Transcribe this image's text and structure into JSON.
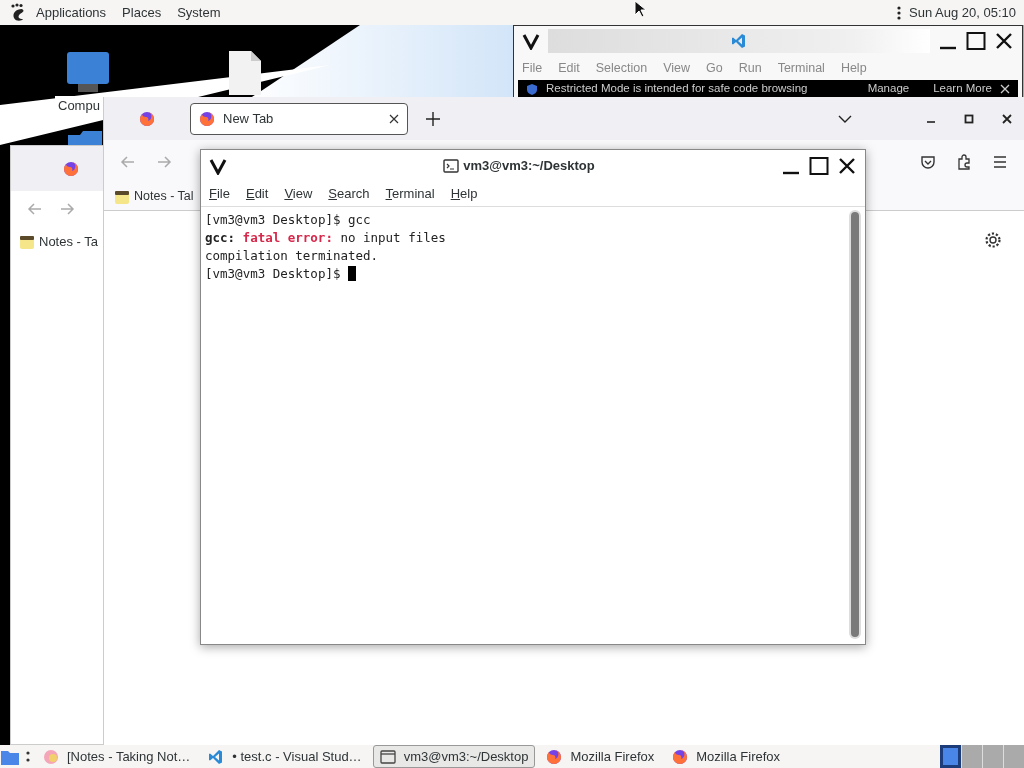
{
  "top_panel": {
    "menus": [
      "Applications",
      "Places",
      "System"
    ],
    "clock": "Sun Aug 20, 05:10"
  },
  "desktop_icons": [
    {
      "label": "Compu"
    }
  ],
  "vscode_window": {
    "menu": [
      "File",
      "Edit",
      "Selection",
      "View",
      "Go",
      "Run",
      "Terminal",
      "Help"
    ],
    "banner": {
      "text": "Restricted Mode is intended for safe code browsing",
      "actions": [
        "Manage",
        "Learn More"
      ]
    }
  },
  "firefox_back": {
    "bookmark": "Notes - Ta"
  },
  "firefox_main": {
    "tabs": [
      {
        "label": "New Tab",
        "selected": true
      }
    ],
    "bookmark": "Notes - Tal"
  },
  "terminal": {
    "title": "vm3@vm3:~/Desktop",
    "menu": [
      "File",
      "Edit",
      "View",
      "Search",
      "Terminal",
      "Help"
    ],
    "lines": [
      {
        "kind": "output",
        "text": "[vm3@vm3 Desktop]$ gcc"
      },
      {
        "kind": "error",
        "program": "gcc:",
        "label": "fatal error:",
        "message": "no input files"
      },
      {
        "kind": "output",
        "text": "compilation terminated."
      },
      {
        "kind": "output",
        "text": "[vm3@vm3 Desktop]$"
      }
    ],
    "cursor": true
  },
  "taskbar": {
    "items": [
      {
        "kind": "notes",
        "label": "[Notes - Taking Not…",
        "selected": false
      },
      {
        "kind": "vscode",
        "label": "• test.c - Visual Stud…",
        "selected": false
      },
      {
        "kind": "terminal",
        "label": "vm3@vm3:~/Desktop",
        "selected": true
      },
      {
        "kind": "firefox",
        "label": "Mozilla Firefox",
        "selected": false
      },
      {
        "kind": "firefox",
        "label": "Mozilla Firefox",
        "selected": false
      }
    ],
    "workspaces": [
      {
        "selected": true
      },
      {
        "selected": false
      },
      {
        "selected": false
      },
      {
        "selected": false
      }
    ]
  }
}
